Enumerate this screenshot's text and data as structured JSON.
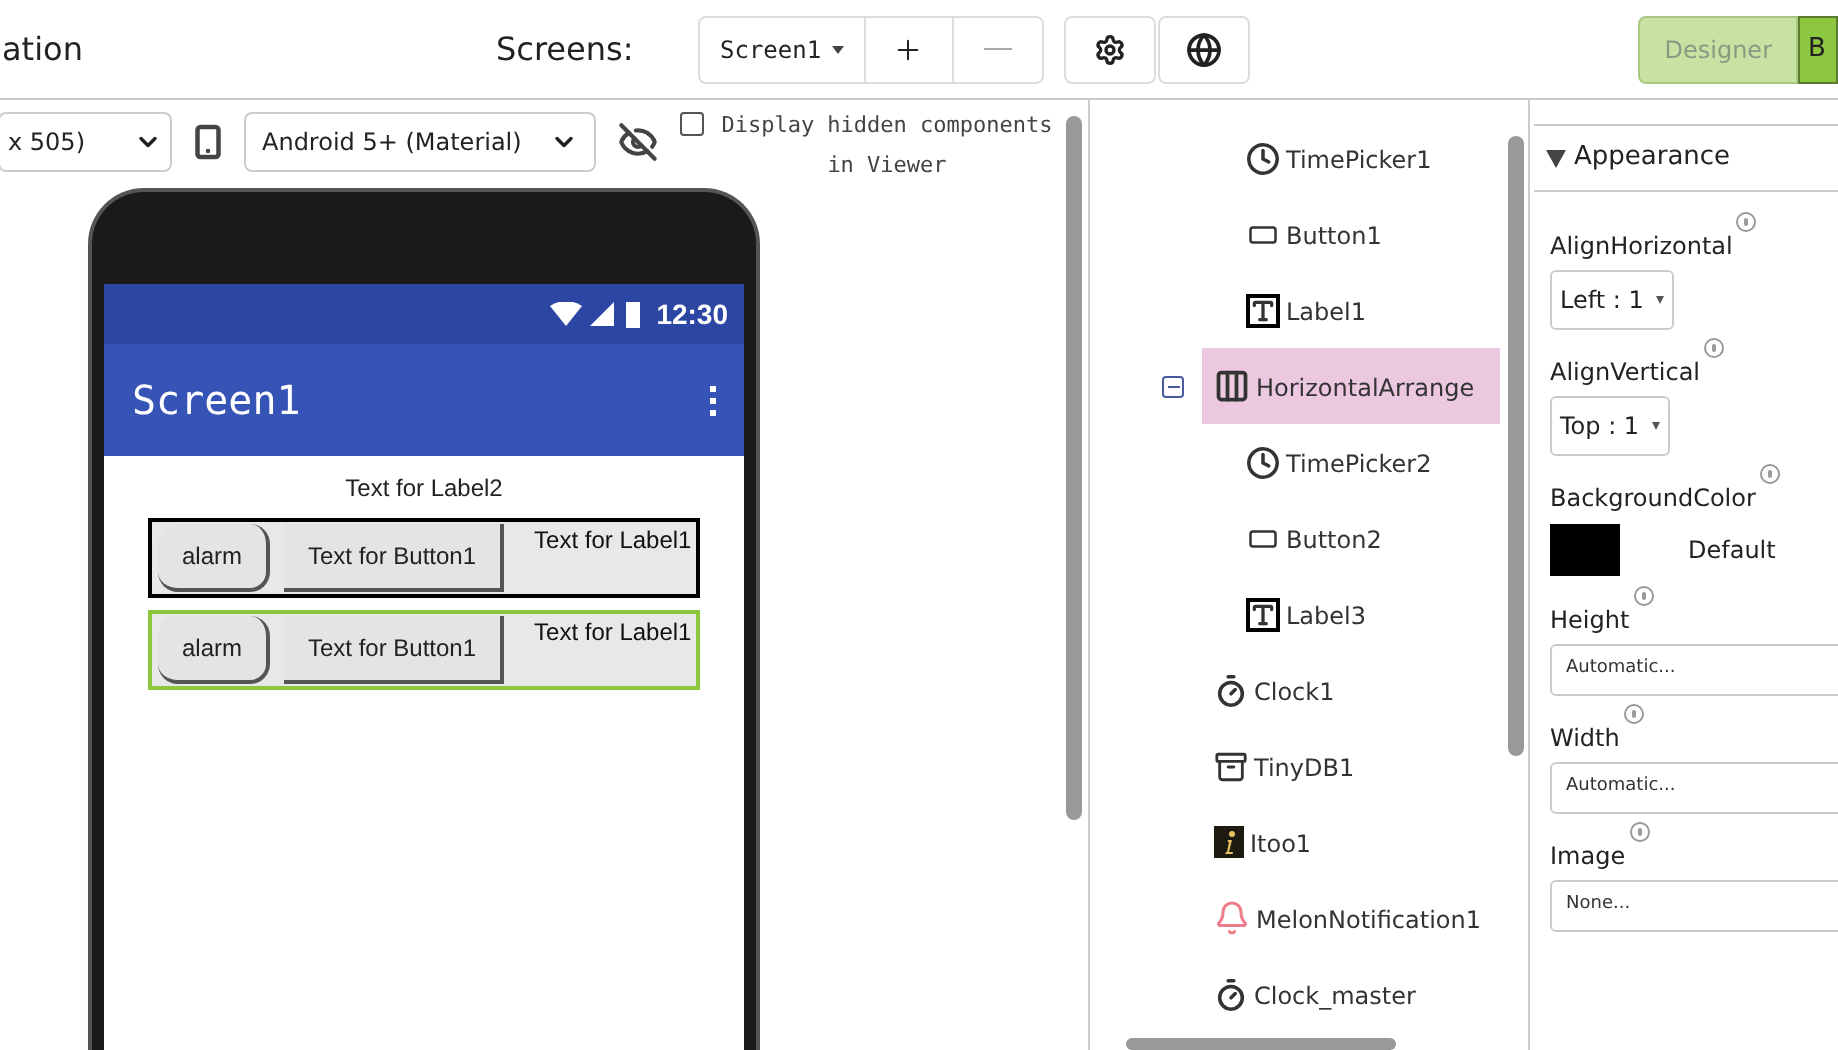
{
  "header": {
    "title": "ation",
    "screens_label": "Screens:",
    "screen_select": "Screen1",
    "designer_button": {
      "label": "Designer",
      "selected": true
    },
    "blocks_button": {
      "label": "B",
      "selected": false
    }
  },
  "viewer_toolbar": {
    "size_select": "x 505)",
    "device_select": "Android 5+ (Material)",
    "hidden_checkbox": {
      "label": "Display hidden components in Viewer",
      "checked": false
    }
  },
  "phone": {
    "time": "12:30",
    "screen_title": "Screen1",
    "label2": "Text for Label2",
    "arrangements": [
      {
        "selected": false,
        "items": [
          {
            "kind": "rounded_button",
            "text": "alarm"
          },
          {
            "kind": "button",
            "text": "Text for Button1"
          },
          {
            "kind": "label",
            "text": "Text for Label1"
          }
        ]
      },
      {
        "selected": true,
        "items": [
          {
            "kind": "rounded_button",
            "text": "alarm"
          },
          {
            "kind": "button",
            "text": "Text for Button1"
          },
          {
            "kind": "label",
            "text": "Text for Label1"
          }
        ]
      }
    ]
  },
  "tree": {
    "items": [
      {
        "kind": "continued",
        "children": [
          {
            "kind": "timepicker",
            "label": "TimePicker1",
            "selected": false
          },
          {
            "kind": "button",
            "label": "Button1",
            "selected": false
          },
          {
            "kind": "label",
            "label": "Label1",
            "selected": false
          }
        ]
      },
      {
        "kind": "arrangement",
        "label": "HorizontalArrange",
        "selected": true,
        "expanded": true,
        "children": [
          {
            "kind": "timepicker",
            "label": "TimePicker2",
            "selected": false
          },
          {
            "kind": "button",
            "label": "Button2",
            "selected": false
          },
          {
            "kind": "label",
            "label": "Label3",
            "selected": false
          }
        ]
      },
      {
        "kind": "clock",
        "label": "Clock1",
        "selected": false
      },
      {
        "kind": "tinydb",
        "label": "TinyDB1",
        "selected": false
      },
      {
        "kind": "info",
        "label": "Itoo1",
        "selected": false
      },
      {
        "kind": "notifier",
        "label": "MelonNotification1",
        "selected": false
      },
      {
        "kind": "clock",
        "label": "Clock_master",
        "selected": false
      }
    ]
  },
  "properties": {
    "section": {
      "label": "Appearance",
      "expanded": true
    },
    "items": [
      {
        "kind": "select",
        "label": "AlignHorizontal",
        "value": "Left : 1"
      },
      {
        "kind": "select",
        "label": "AlignVertical",
        "value": "Top : 1"
      },
      {
        "kind": "color",
        "label": "BackgroundColor",
        "color": "#000000",
        "value": "Default"
      },
      {
        "kind": "text",
        "label": "Height",
        "value": "Automatic..."
      },
      {
        "kind": "text",
        "label": "Width",
        "value": "Automatic..."
      },
      {
        "kind": "text",
        "label": "Image",
        "value": "None..."
      }
    ]
  }
}
